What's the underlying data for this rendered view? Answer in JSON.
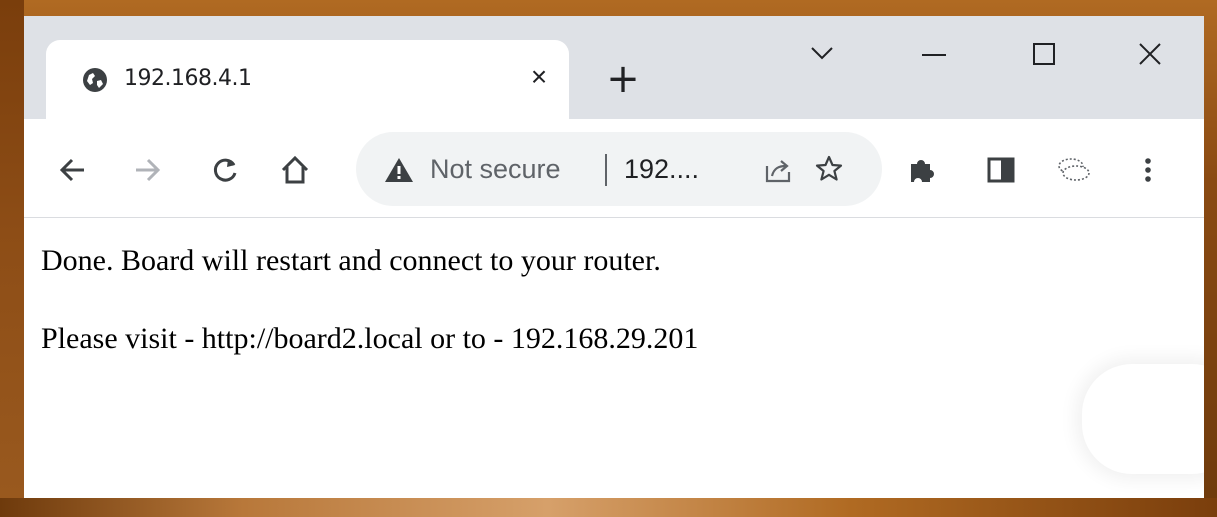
{
  "browser": {
    "tab": {
      "title": "192.168.4.1",
      "favicon": "globe-icon",
      "close_glyph": "×"
    },
    "new_tab_glyph": "+",
    "window_controls": {
      "tab_search_glyph": "chevron-down-icon",
      "minimize_glyph": "minimize-icon",
      "maximize_glyph": "maximize-icon",
      "close_glyph": "close-icon"
    },
    "toolbar": {
      "back": "arrow-left-icon",
      "forward": "arrow-right-icon",
      "reload": "reload-icon",
      "home": "home-icon",
      "omnibox": {
        "security_icon": "warning-icon",
        "security_label": "Not secure",
        "url": "192...."
      },
      "share": "share-icon",
      "bookmark": "star-icon",
      "extensions": "puzzle-icon",
      "side_panel": "side-panel-icon",
      "profile": "profile-icon",
      "menu": "kebab-menu-icon"
    }
  },
  "page": {
    "line1": "Done. Board will restart and connect to your router.",
    "line2": "Please visit - http://board2.local or to - 192.168.29.201"
  },
  "colors": {
    "tabstrip": "#dee1e6",
    "omnibox": "#f1f3f4",
    "icon": "#5f6368",
    "text": "#202124"
  }
}
